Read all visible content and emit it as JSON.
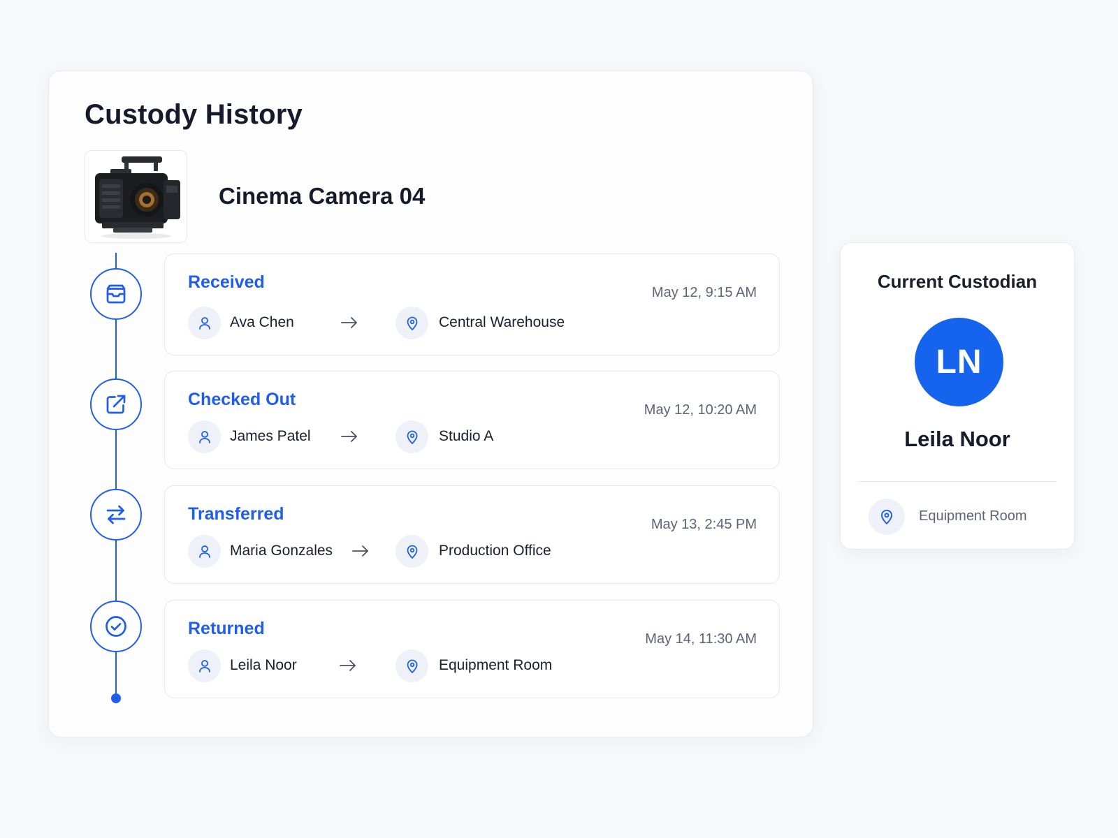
{
  "page": {
    "title": "Custody History",
    "accent_color": "#1f5eea"
  },
  "asset": {
    "name": "Cinema Camera 04",
    "image": "cinema-camera-photo"
  },
  "events": [
    {
      "status": "Received",
      "icon": "inbox-icon",
      "timestamp": "May 12, 9:15 AM",
      "person": "Ava Chen",
      "location": "Central Warehouse"
    },
    {
      "status": "Checked Out",
      "icon": "external-link-icon",
      "timestamp": "May 12, 10:20 AM",
      "person": "James Patel",
      "location": "Studio A"
    },
    {
      "status": "Transferred",
      "icon": "swap-arrows-icon",
      "timestamp": "May 13, 2:45 PM",
      "person": "Maria Gonzales",
      "location": "Production Office"
    },
    {
      "status": "Returned",
      "icon": "check-circle-icon",
      "timestamp": "May 14, 11:30 AM",
      "person": "Leila Noor",
      "location": "Equipment Room"
    }
  ],
  "custodian": {
    "heading": "Current Custodian",
    "initials": "LN",
    "name": "Leila Noor",
    "location": "Equipment Room",
    "avatar_color": "#1664ee"
  }
}
